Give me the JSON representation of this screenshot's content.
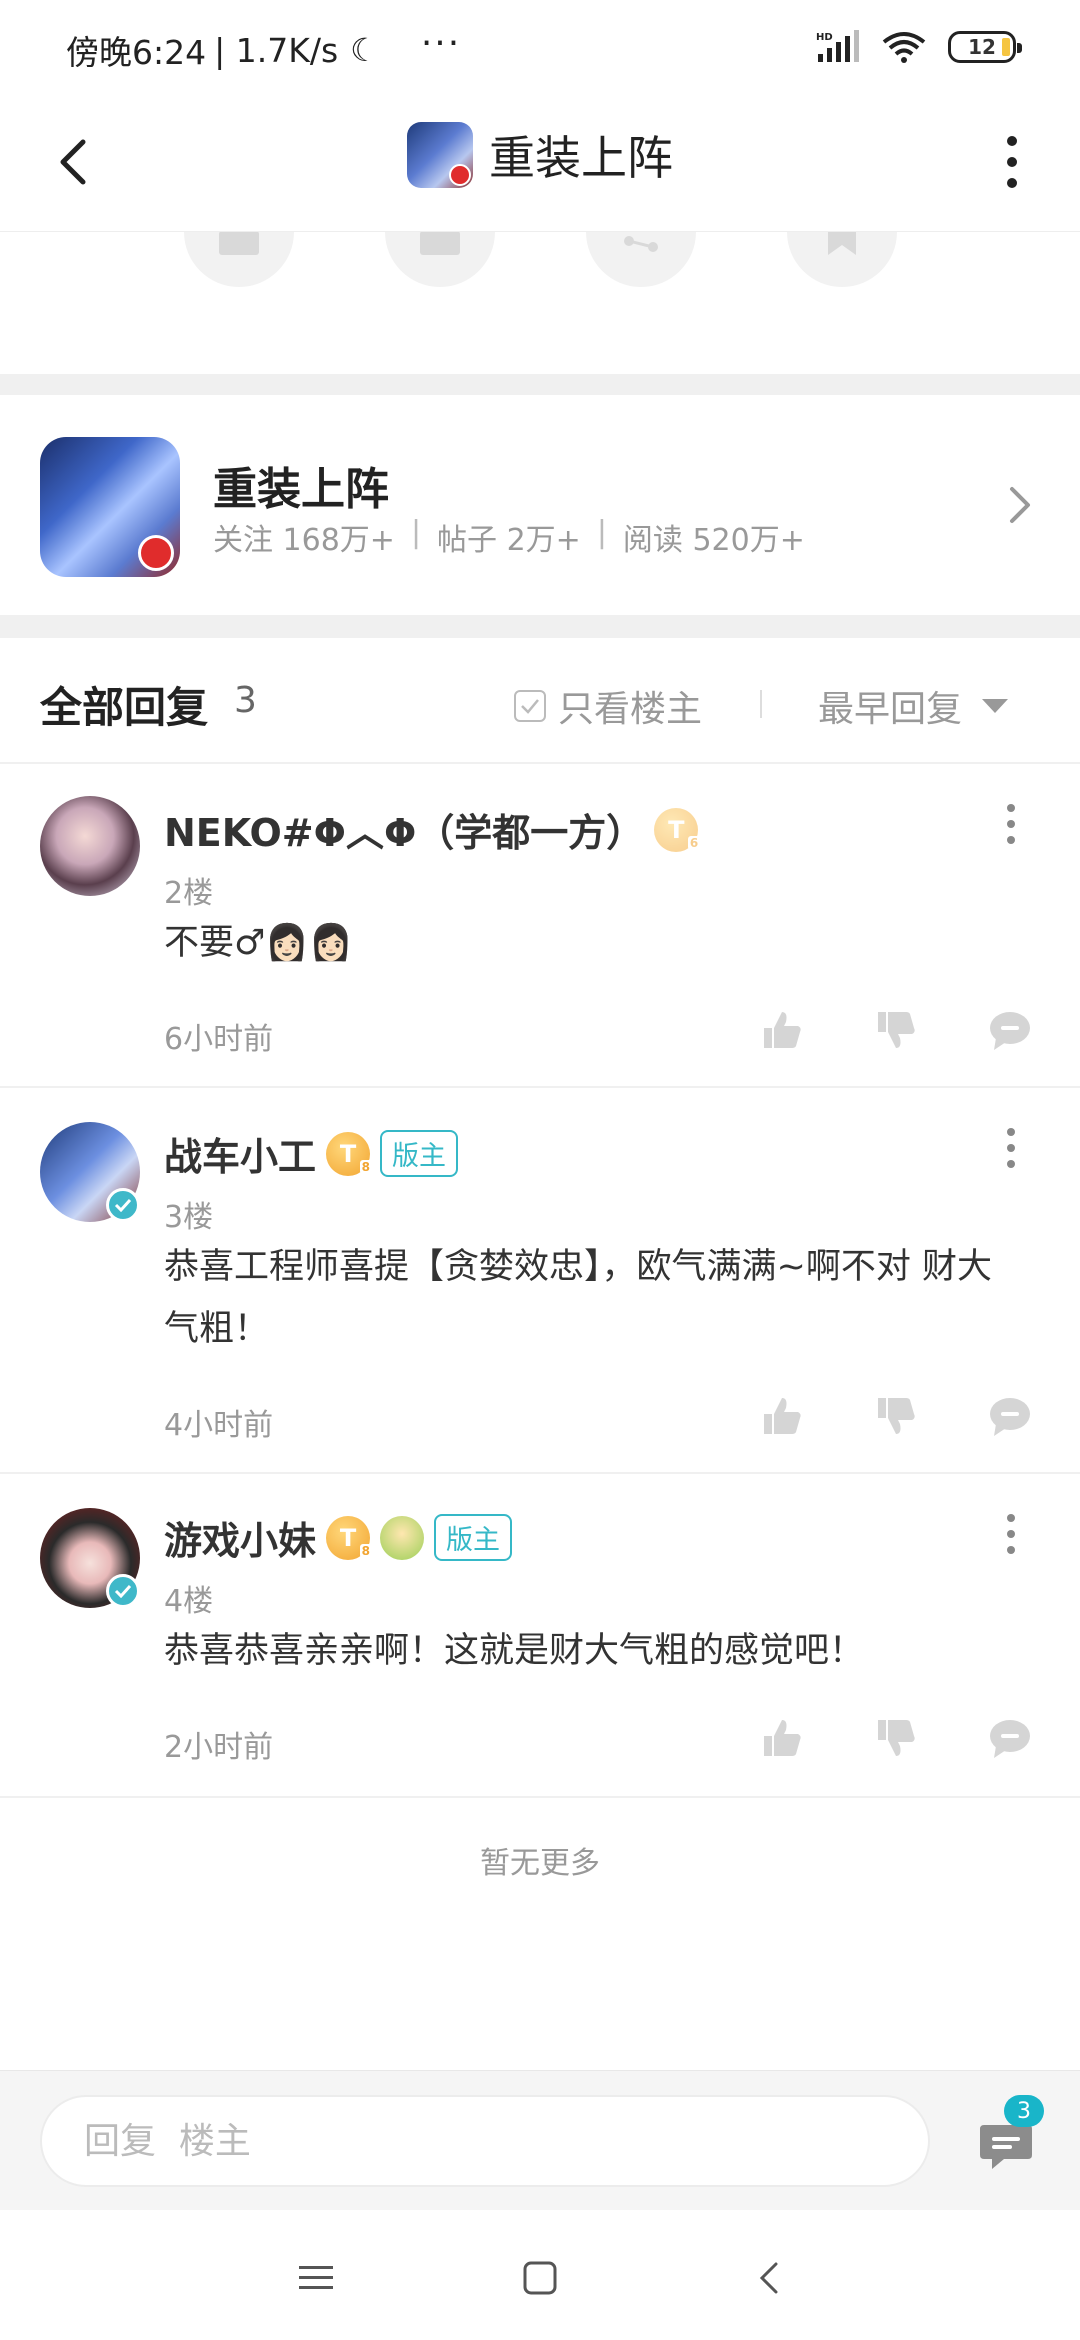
{
  "status_bar": {
    "time": "傍晚6:24",
    "speed": "| 1.7K/s",
    "more": "···",
    "signal_label": "HD",
    "battery": "12"
  },
  "header": {
    "title": "重装上阵"
  },
  "game_card": {
    "name": "重装上阵",
    "follow": "关注 168万+",
    "posts": "帖子 2万+",
    "reads": "阅读 520万+",
    "separator": "|"
  },
  "replies": {
    "title": "全部回复",
    "count": "3",
    "only_op_label": "只看楼主",
    "sort_label": "最早回复"
  },
  "comments": [
    {
      "username": "NEKO#Φ︿Φ（学都一方）",
      "level": "T",
      "level_num": "6",
      "floor": "2楼",
      "content": "不要♂👩🏻👩🏻",
      "time": "6小时前"
    },
    {
      "username": "战车小工",
      "level": "T",
      "level_num": "8",
      "mod_tag": "版主",
      "floor": "3楼",
      "content": "恭喜工程师喜提【贪婪效忠】，欧气满满~啊不对 财大气粗！",
      "time": "4小时前"
    },
    {
      "username": "游戏小妹",
      "level": "T",
      "level_num": "8",
      "mod_tag": "版主",
      "floor": "4楼",
      "content": "恭喜恭喜亲亲啊！这就是财大气粗的感觉吧！",
      "time": "2小时前"
    }
  ],
  "footer": {
    "no_more": "暂无更多",
    "input_placeholder": "回复  楼主",
    "comment_badge": "3"
  },
  "colors": {
    "accent": "#35b8c7",
    "badge": "#19b5c9",
    "level_gold": "#f2a531",
    "muted": "#999999",
    "separator": "#f0f0f0"
  },
  "icons": {
    "like": "thumbs-up-icon",
    "dislike": "thumbs-down-icon",
    "comment": "comment-bubble-icon",
    "share": "share-icon",
    "bookmark": "bookmark-icon"
  }
}
